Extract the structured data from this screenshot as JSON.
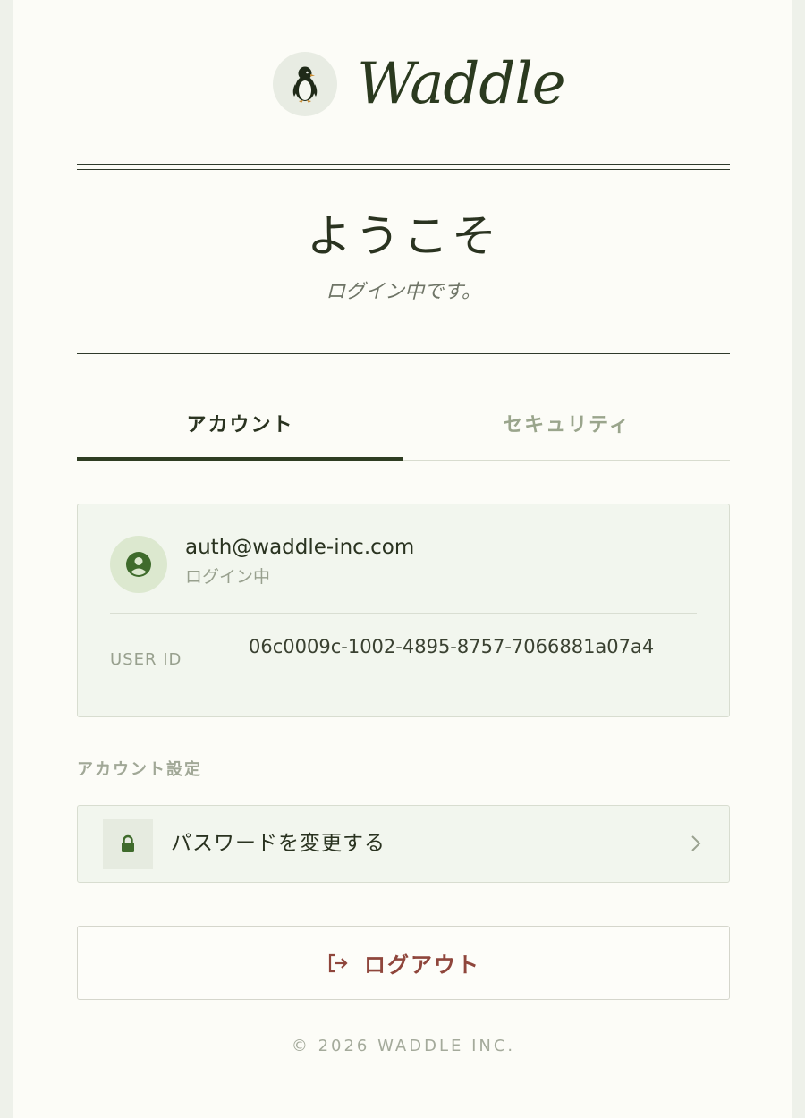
{
  "brand": {
    "name": "Waddle",
    "logo_icon": "penguin-icon"
  },
  "welcome": {
    "title": "ようこそ",
    "subtitle": "ログイン中です。"
  },
  "tabs": [
    {
      "label": "アカウント",
      "active": true
    },
    {
      "label": "セキュリティ",
      "active": false
    }
  ],
  "account": {
    "avatar_icon": "user-circle-icon",
    "email": "auth@waddle-inc.com",
    "status": "ログイン中",
    "user_id_label": "USER ID",
    "user_id": "06c0009c-1002-4895-8757-7066881a07a4"
  },
  "settings": {
    "section_label": "アカウント設定",
    "items": [
      {
        "label": "パスワードを変更する",
        "icon": "lock-icon",
        "trailing_icon": "chevron-right-icon"
      }
    ]
  },
  "logout": {
    "label": "ログアウト",
    "icon": "logout-icon"
  },
  "footer": {
    "copyright": "© 2026 WADDLE INC."
  },
  "colors": {
    "brand_dark": "#2b3a1f",
    "accent_green": "#3f6b2c",
    "logout_red": "#8f463c",
    "card_bg": "#f2f6ee",
    "page_bg": "#fcfcf7"
  }
}
